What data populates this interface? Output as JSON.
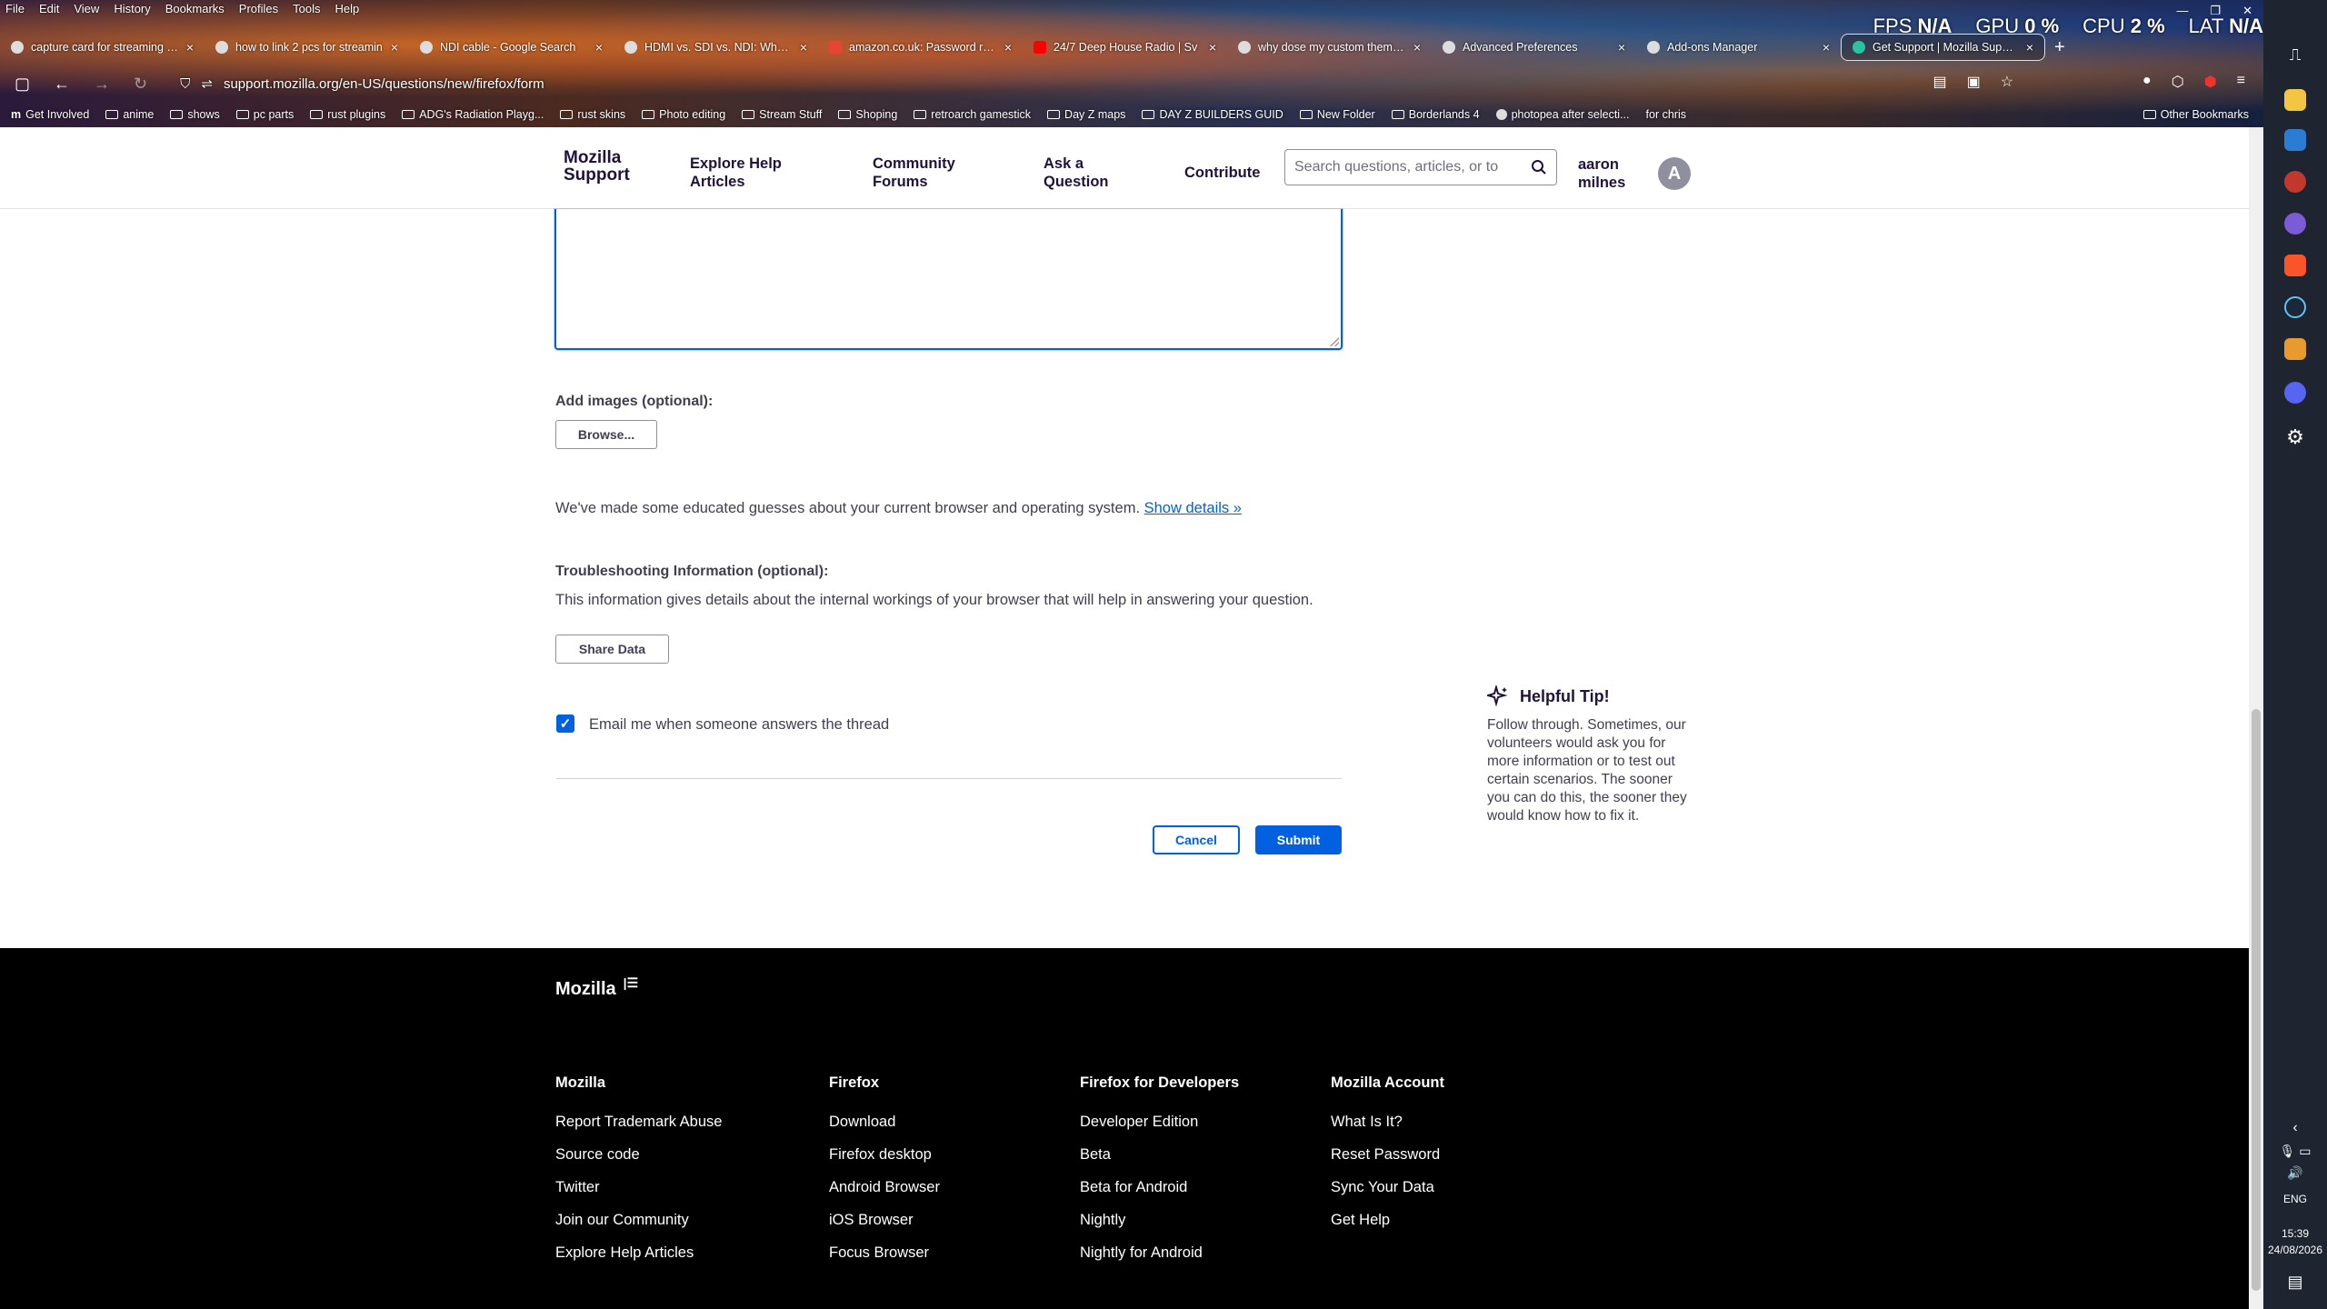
{
  "menu": [
    "File",
    "Edit",
    "View",
    "History",
    "Bookmarks",
    "Profiles",
    "Tools",
    "Help"
  ],
  "hud": {
    "fps_label": "FPS",
    "fps_value": "N/A",
    "gpu_label": "GPU",
    "gpu_value": "0 %",
    "cpu_label": "CPU",
    "cpu_value": "2 %",
    "lat_label": "LAT",
    "lat_value": "N/A"
  },
  "tabs": [
    {
      "label": "capture card for streaming - Go"
    },
    {
      "label": "how to link 2 pcs for streamin"
    },
    {
      "label": "NDI cable - Google Search"
    },
    {
      "label": "HDMI vs. SDI vs. NDI: What Are"
    },
    {
      "label": "amazon.co.uk: Password recov"
    },
    {
      "label": "24/7 Deep House Radio | Sv"
    },
    {
      "label": "why dose my custom theme of"
    },
    {
      "label": "Advanced Preferences"
    },
    {
      "label": "Add-ons Manager"
    },
    {
      "label": "Get Support | Mozilla Support"
    }
  ],
  "url": "support.mozilla.org/en-US/questions/new/firefox/form",
  "bookmarks": [
    "Get Involved",
    "anime",
    "shows",
    "pc parts",
    "rust plugins",
    "ADG's Radiation Playg...",
    "rust skins",
    "Photo editing",
    "Stream Stuff",
    "Shoping",
    "retroarch gamestick",
    "Day Z maps",
    "DAY Z BUILDERS GUID",
    "New Folder",
    "Borderlands 4",
    "photopea after selecti...",
    "for chris"
  ],
  "other_bookmarks": "Other Bookmarks",
  "header": {
    "logo_line1": "Mozilla",
    "logo_line2": "Support",
    "nav": [
      {
        "line1": "Explore Help",
        "line2": "Articles"
      },
      {
        "line1": "Community",
        "line2": "Forums"
      },
      {
        "line1": "Ask a",
        "line2": "Question"
      },
      {
        "line1": "Contribute",
        "line2": ""
      }
    ],
    "search_placeholder": "Search questions, articles, or to",
    "user_line1": "aaron",
    "user_line2": "milnes",
    "avatar_letter": "A"
  },
  "form": {
    "add_images_label": "Add images (optional):",
    "browse_label": "Browse...",
    "guesses_text": "We've made some educated guesses about your current browser and operating system.",
    "show_details": "Show details »",
    "troubleshoot_label": "Troubleshooting Information (optional):",
    "troubleshoot_text": "This information gives details about the internal workings of your browser that will help in answering your question.",
    "share_data_label": "Share Data",
    "email_checked": true,
    "email_label": "Email me when someone answers the thread",
    "cancel_label": "Cancel",
    "submit_label": "Submit"
  },
  "tip": {
    "title": "Helpful Tip!",
    "body": "Follow through. Sometimes, our volunteers would ask you for more information or to test out certain scenarios. The sooner you can do this, the sooner they would know how to fix it."
  },
  "footer": {
    "logo": "Mozilla",
    "columns": [
      {
        "heading": "Mozilla",
        "links": [
          "Report Trademark Abuse",
          "Source code",
          "Twitter",
          "Join our Community",
          "Explore Help Articles"
        ]
      },
      {
        "heading": "Firefox",
        "links": [
          "Download",
          "Firefox desktop",
          "Android Browser",
          "iOS Browser",
          "Focus Browser"
        ]
      },
      {
        "heading": "Firefox for Developers",
        "links": [
          "Developer Edition",
          "Beta",
          "Beta for Android",
          "Nightly",
          "Nightly for Android"
        ]
      },
      {
        "heading": "Mozilla Account",
        "links": [
          "What Is It?",
          "Reset Password",
          "Sync Your Data",
          "Get Help"
        ]
      }
    ]
  },
  "taskbar": {
    "lang": "ENG",
    "time": "15:39",
    "date": "24/08/2026"
  },
  "colors": {
    "accent": "#0060df",
    "footer_bg": "#000000",
    "text": "#3f3f52"
  }
}
